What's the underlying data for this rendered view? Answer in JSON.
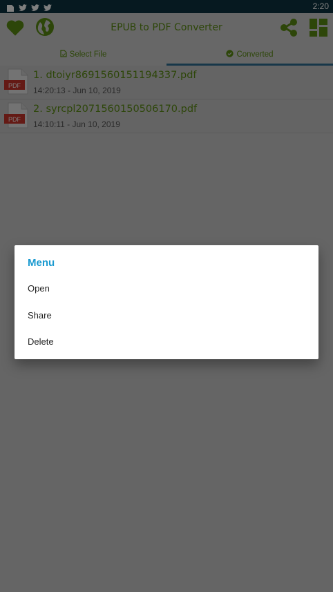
{
  "status_bar": {
    "time": "2:20",
    "icons": [
      "notification-icon",
      "twitter-icon",
      "twitter-icon",
      "twitter-icon"
    ]
  },
  "app_bar": {
    "title": "EPUB to PDF Converter",
    "accent_color": "#5b8c12"
  },
  "tabs": [
    {
      "label": "Select File",
      "icon": "file-icon",
      "active": false
    },
    {
      "label": "Converted",
      "icon": "check-circle-icon",
      "active": true
    }
  ],
  "files": [
    {
      "name": "1. dtoiyr8691560151194337.pdf",
      "date": "14:20:13 - Jun 10, 2019",
      "icon_label": "PDF"
    },
    {
      "name": "2. syrcpl2071560150506170.pdf",
      "date": "14:10:11 - Jun 10, 2019",
      "icon_label": "PDF"
    }
  ],
  "menu_dialog": {
    "title": "Menu",
    "items": [
      "Open",
      "Share",
      "Delete"
    ],
    "title_color": "#1a9ad0"
  }
}
